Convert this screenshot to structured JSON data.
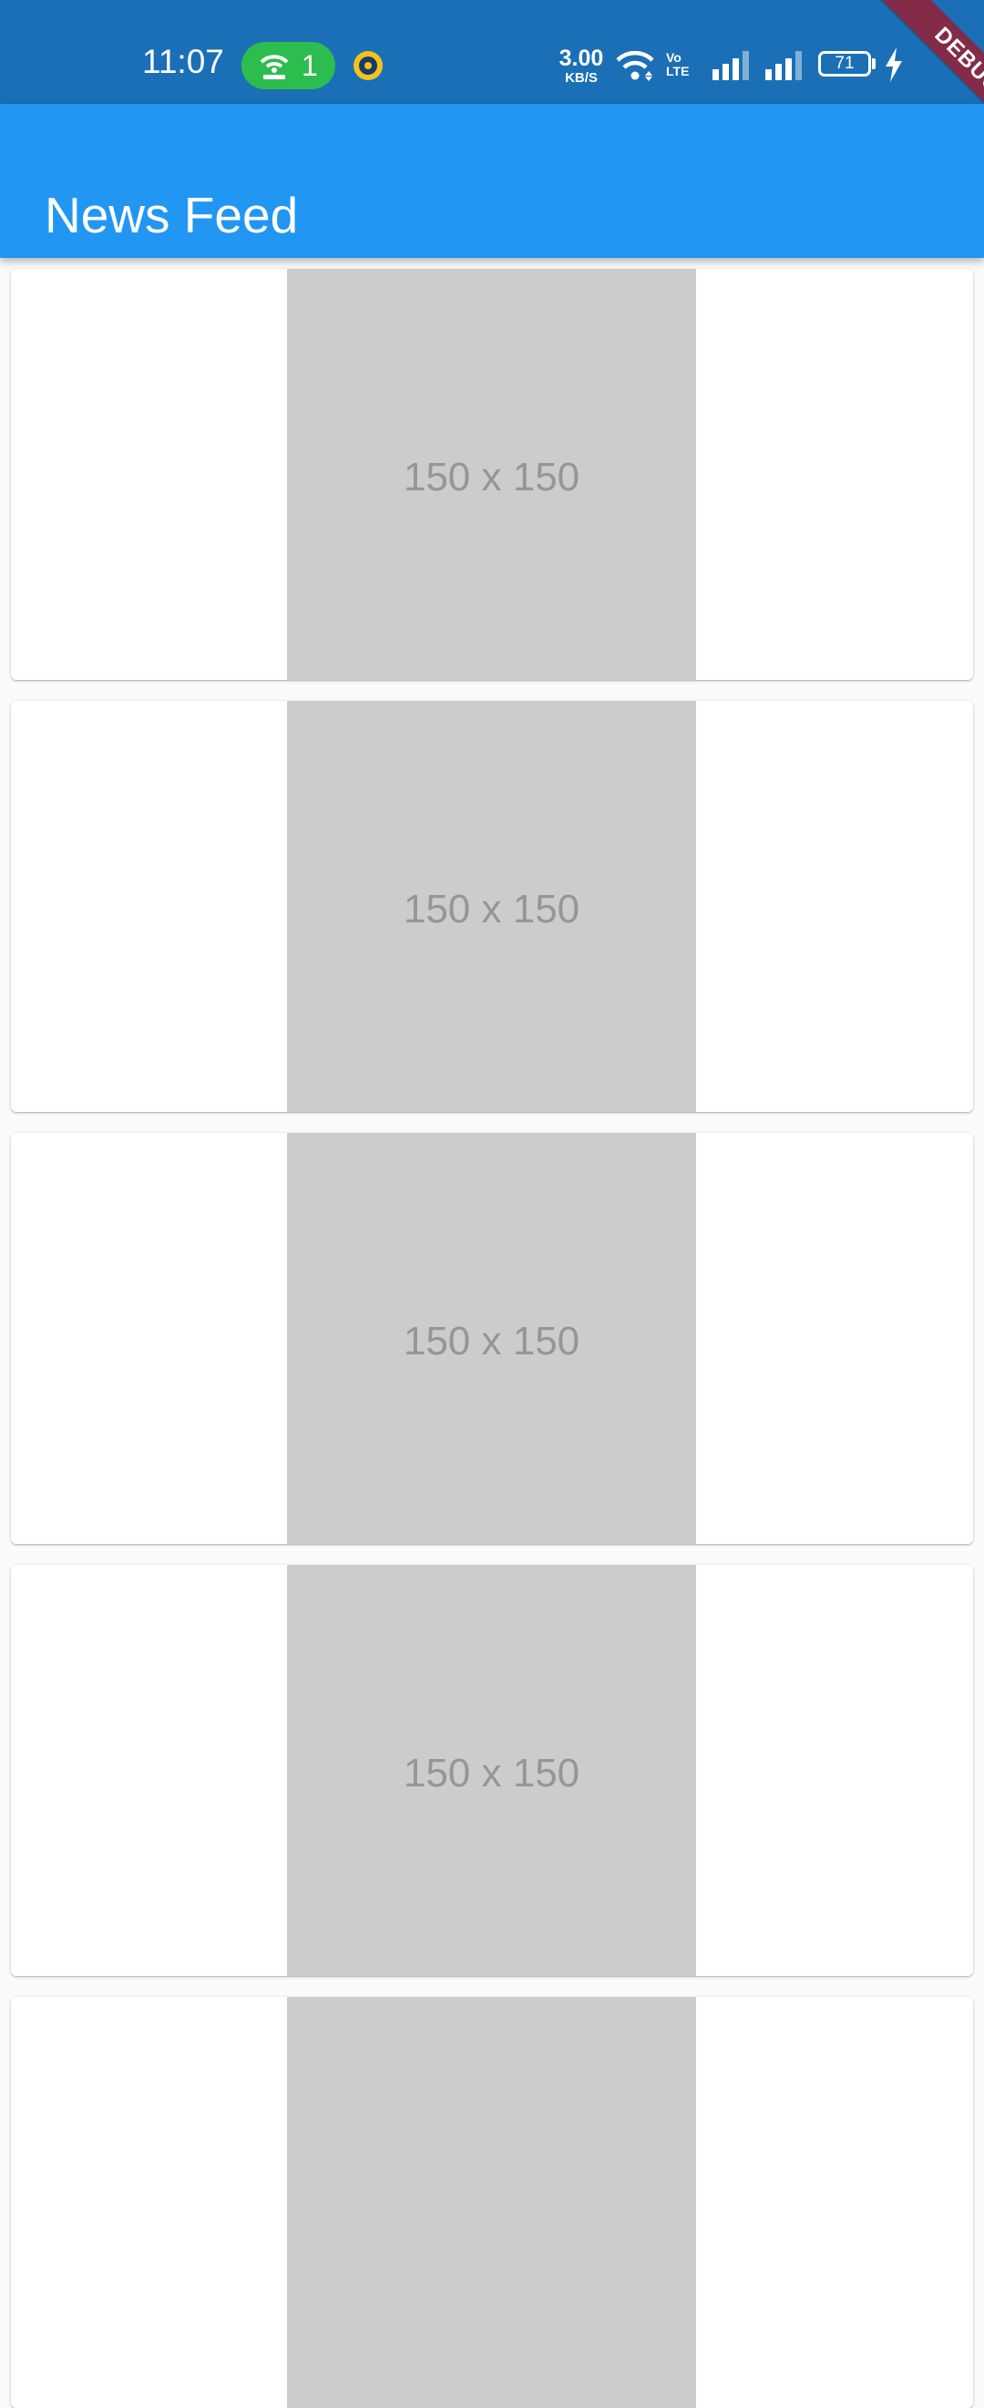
{
  "status_bar": {
    "time": "11:07",
    "hotspot_count": "1",
    "net_speed_value": "3.00",
    "net_speed_unit": "KB/S",
    "volte_top": "Vo",
    "volte_bottom": "LTE",
    "battery_level": "71",
    "icons": [
      "hotspot-icon",
      "app-notification-icon",
      "wifi-icon",
      "signal-icon",
      "signal-icon",
      "battery-icon",
      "charging-icon"
    ]
  },
  "app_bar": {
    "title": "News Feed",
    "color": "#2196f3"
  },
  "debug_banner": "DEBUG",
  "feed": {
    "cards": [
      {
        "image_label": "150 x 150"
      },
      {
        "image_label": "150 x 150"
      },
      {
        "image_label": "150 x 150"
      },
      {
        "image_label": "150 x 150"
      },
      {
        "image_label": ""
      }
    ]
  }
}
